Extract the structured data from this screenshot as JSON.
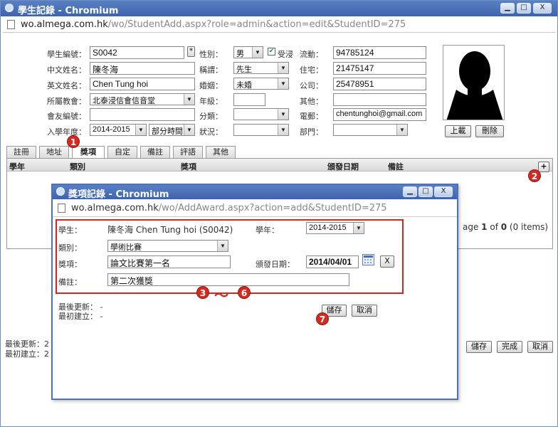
{
  "window": {
    "title": "學生記錄 - Chromium",
    "url_host": "wo.almega.com.hk",
    "url_path": "/wo/StudentAdd.aspx?role=admin&action=edit&StudentID=275",
    "minimize_glyph": "▁",
    "maximize_glyph": "□",
    "close_glyph": "X"
  },
  "form": {
    "student_no": {
      "label": "學生編號：",
      "value": "S0042",
      "star": "*"
    },
    "chinese_name": {
      "label": "中文姓名：",
      "value": "陳冬海"
    },
    "english_name": {
      "label": "英文姓名：",
      "value": "Chen Tung hoi"
    },
    "church": {
      "label": "所屬教會：",
      "value": "北泰浸信會信音堂"
    },
    "member_no": {
      "label": "會友編號：",
      "value": ""
    },
    "enroll_year": {
      "label": "入學年度：",
      "year": "2014-2015",
      "mode": "部分時間"
    },
    "gender": {
      "label": "性別：",
      "value": "男",
      "baptized": "受浸"
    },
    "title": {
      "label": "稱謂：",
      "value": "先生"
    },
    "marital": {
      "label": "婚姻：",
      "value": "未婚"
    },
    "grade": {
      "label": "年級：",
      "value": ""
    },
    "category": {
      "label": "分類：",
      "value": ""
    },
    "status": {
      "label": "狀況：",
      "value": ""
    },
    "mobile": {
      "label": "流動：",
      "value": "94785124"
    },
    "home": {
      "label": "住宅：",
      "value": "21475147"
    },
    "office": {
      "label": "公司：",
      "value": "25478951"
    },
    "other": {
      "label": "其他：",
      "value": ""
    },
    "email": {
      "label": "電郵：",
      "value": "chentunghoi@gmail.com"
    },
    "dept": {
      "label": "部門：",
      "value": ""
    },
    "upload_label": "上載",
    "delete_label": "刪除"
  },
  "tabs": [
    "註冊",
    "地址",
    "獎項",
    "自定",
    "備註",
    "評語",
    "其他"
  ],
  "awards_table": {
    "headers": [
      "學年",
      "類別",
      "獎項",
      "頒發日期",
      "備註"
    ],
    "add_glyph": "+",
    "pager_prefix": "age ",
    "pager_page": "1",
    "pager_of": " of ",
    "pager_total": "0",
    "pager_suffix": " (0 items)"
  },
  "bottom": {
    "last_update": "最後更新：2",
    "created": "最初建立：2",
    "save_label": "儲存",
    "done_label": "完成",
    "cancel_label": "取消"
  },
  "popup": {
    "title": "獎項記錄 - Chromium",
    "url_host": "wo.almega.com.hk",
    "url_path": "/wo/AddAward.aspx?action=add&StudentID=275",
    "student_label": "學生：",
    "student_value": "陳冬海 Chen Tung hoi (S0042)",
    "year_label": "學年：",
    "year_value": "2014-2015",
    "category_label": "類別：",
    "category_value": "學術比賽",
    "award_label": "獎項：",
    "award_value": "論文比賽第一名",
    "date_label": "頒發日期：",
    "date_value": "2014/04/01",
    "clear_label": "X",
    "remark_label": "備註：",
    "remark_value": "第二次獲獎",
    "last_update": "最後更新： -",
    "created": "最初建立： -",
    "save_label": "儲存",
    "cancel_label": "取消"
  },
  "callouts": {
    "one": "1",
    "two": "2",
    "three": "3",
    "tilde": "～",
    "six": "6",
    "seven": "7"
  },
  "colors": {
    "titlebar": "#3d63ad",
    "callout": "#d62a20",
    "highlight_box": "#d6261e"
  },
  "icons": [
    "chromium-logo-icon",
    "page-icon",
    "calendar-icon",
    "avatar-silhouette"
  ]
}
